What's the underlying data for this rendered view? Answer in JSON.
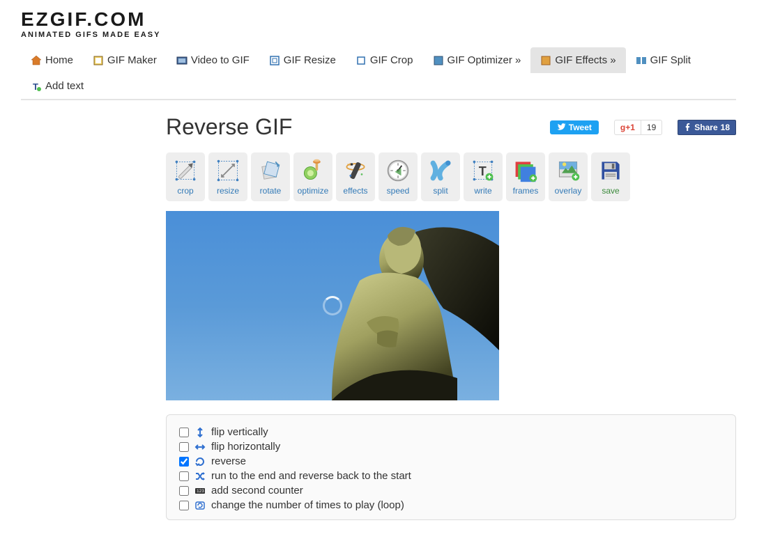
{
  "logo": {
    "title": "EZGIF.COM",
    "subtitle": "ANIMATED GIFS MADE EASY"
  },
  "nav": [
    {
      "label": "Home"
    },
    {
      "label": "GIF Maker"
    },
    {
      "label": "Video to GIF"
    },
    {
      "label": "GIF Resize"
    },
    {
      "label": "GIF Crop"
    },
    {
      "label": "GIF Optimizer »"
    },
    {
      "label": "GIF Effects »"
    },
    {
      "label": "GIF Split"
    },
    {
      "label": "Add text"
    }
  ],
  "pageTitle": "Reverse GIF",
  "social": {
    "tweet": "Tweet",
    "gplus_count": "19",
    "fb_label": "Share",
    "fb_count": "18"
  },
  "tools": [
    {
      "label": "crop"
    },
    {
      "label": "resize"
    },
    {
      "label": "rotate"
    },
    {
      "label": "optimize"
    },
    {
      "label": "effects"
    },
    {
      "label": "speed"
    },
    {
      "label": "split"
    },
    {
      "label": "write"
    },
    {
      "label": "frames"
    },
    {
      "label": "overlay"
    },
    {
      "label": "save"
    }
  ],
  "options": [
    {
      "label": "flip vertically",
      "checked": false
    },
    {
      "label": "flip horizontally",
      "checked": false
    },
    {
      "label": "reverse",
      "checked": true
    },
    {
      "label": "run to the end and reverse back to the start",
      "checked": false
    },
    {
      "label": "add second counter",
      "checked": false
    },
    {
      "label": "change the number of times to play (loop)",
      "checked": false
    }
  ]
}
